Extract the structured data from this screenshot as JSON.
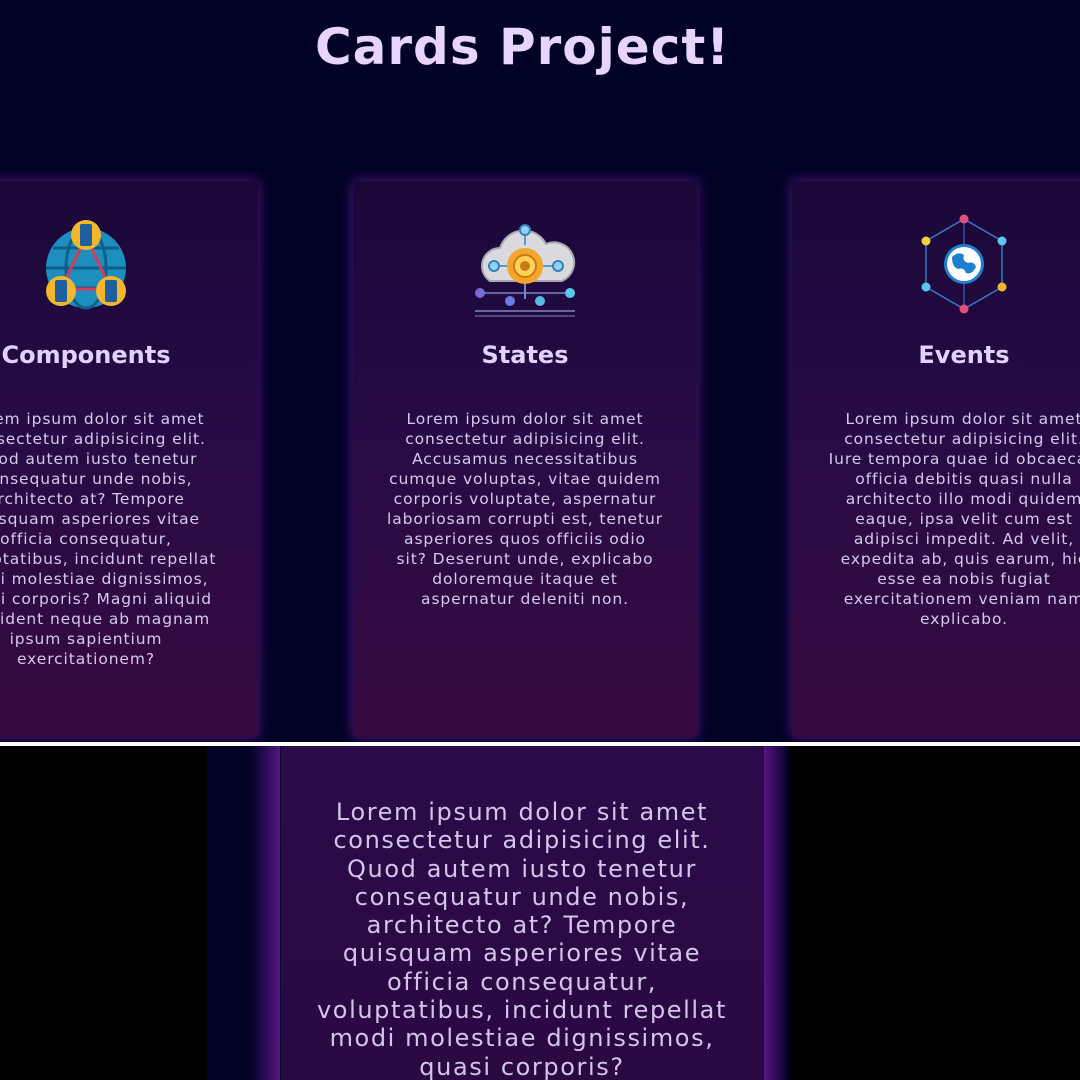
{
  "title": "Cards Project!",
  "cards": [
    {
      "heading": "Components",
      "icon": "network-globe-servers-icon",
      "text": "Lorem ipsum dolor sit amet consectetur adipisicing elit. Quod autem iusto tenetur consequatur unde nobis, architecto at? Tempore quisquam asperiores vitae officia consequatur, voluptatibus, incidunt repellat modi molestiae dignissimos, quasi corporis? Magni aliquid provident neque ab magnam ipsum sapientium exercitationem?"
    },
    {
      "heading": "States",
      "icon": "cloud-gear-icon",
      "text": "Lorem ipsum dolor sit amet consectetur adipisicing elit. Accusamus necessitatibus cumque voluptas, vitae quidem corporis voluptate, aspernatur laboriosam corrupti est, tenetur asperiores quos officiis odio sit? Deserunt unde, explicabo doloremque itaque et aspernatur deleniti non."
    },
    {
      "heading": "Events",
      "icon": "globe-hexagon-nodes-icon",
      "text": "Lorem ipsum dolor sit amet consectetur adipisicing elit. Iure tempora quae id obcaecati officia debitis quasi nulla architecto illo modi quidem eaque, ipsa velit cum est adipisci impedit. Ad velit, expedita ab, quis earum, hic esse ea nobis fugiat exercitationem veniam nam explicabo."
    }
  ],
  "zoom_panel": {
    "text": "Lorem ipsum dolor sit amet consectetur adipisicing elit. Quod autem iusto tenetur consequatur unde nobis, architecto at? Tempore quisquam asperiores vitae officia consequatur, voluptatibus, incidunt repellat modi molestiae dignissimos, quasi corporis?"
  },
  "colors": {
    "page_bg": "#020225",
    "title": "#e7d4ff",
    "card_top": "#1a0838",
    "card_bottom": "#360a3f",
    "card_text": "#d6c8ee",
    "glow": "#8c28c8"
  }
}
